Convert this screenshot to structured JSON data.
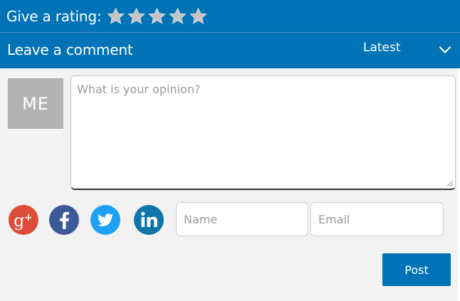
{
  "rating": {
    "label": "Give a rating:",
    "stars_total": 5,
    "stars_selected": 0,
    "star_color": "#c4c4c4"
  },
  "comments": {
    "title": "Leave a comment",
    "sort": {
      "selected": "Latest",
      "icon": "chevron-down-icon"
    }
  },
  "composer": {
    "avatar_text": "ME",
    "opinion_placeholder": "What is your opinion?",
    "name_placeholder": "Name",
    "email_placeholder": "Email",
    "post_label": "Post"
  },
  "social": [
    {
      "name": "google-plus",
      "icon": "google-plus-icon",
      "color": "#dd4b39"
    },
    {
      "name": "facebook",
      "icon": "facebook-icon",
      "color": "#3b5998"
    },
    {
      "name": "twitter",
      "icon": "twitter-icon",
      "color": "#1da1f2"
    },
    {
      "name": "linkedin",
      "icon": "linkedin-icon",
      "color": "#0e76a8"
    }
  ],
  "colors": {
    "brand": "#0073b7",
    "background": "#f2f2f2",
    "avatar": "#b3b3b3"
  }
}
